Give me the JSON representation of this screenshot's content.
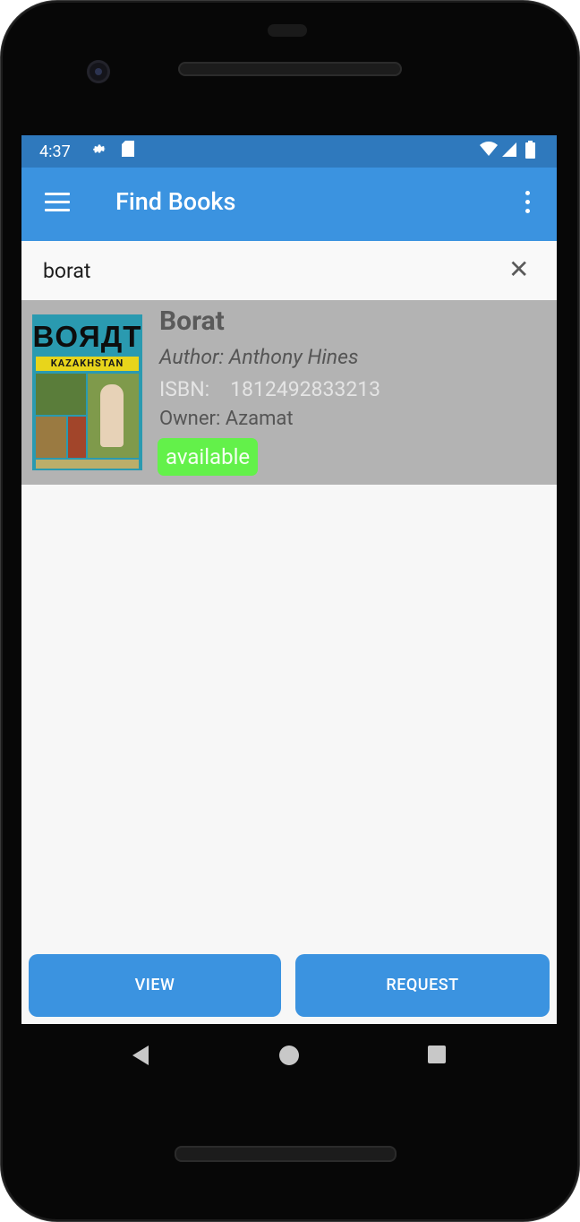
{
  "status_bar": {
    "time": "4:37",
    "left_icons": [
      "gear-icon",
      "sd-card-icon"
    ],
    "right_icons": [
      "wifi-icon",
      "signal-icon",
      "battery-icon"
    ]
  },
  "app_bar": {
    "title": "Find Books",
    "color": "#3b93e0"
  },
  "search": {
    "query": "borat",
    "clear_icon": "close-icon"
  },
  "results": [
    {
      "cover_text": "BOЯДT",
      "cover_subtitle": "KAZAKHSTAN",
      "title": "Borat",
      "author": "Author: Anthony Hines",
      "isbn_label": "ISBN:",
      "isbn": "1812492833213",
      "owner": "Owner: Azamat",
      "status": "available",
      "status_color": "#63f14a"
    }
  ],
  "actions": {
    "view_label": "VIEW",
    "request_label": "REQUEST"
  },
  "navigation": {
    "buttons": [
      "back-icon",
      "home-icon",
      "recents-icon"
    ]
  }
}
